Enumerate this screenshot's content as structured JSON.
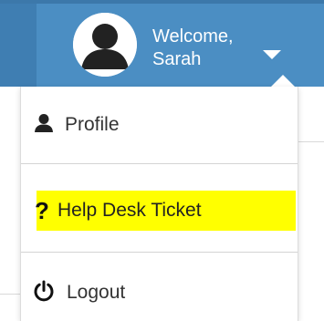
{
  "header": {
    "welcome": "Welcome,",
    "user_name": "Sarah",
    "avatar_icon": "user-avatar-icon",
    "caret_icon": "chevron-down-icon",
    "bar_color": "#4b8ec3"
  },
  "menu": {
    "items": [
      {
        "label": "Profile",
        "icon": "user-icon"
      },
      {
        "label": "Help Desk Ticket",
        "icon": "question-icon",
        "highlight": "#ffff00"
      },
      {
        "label": "Logout",
        "icon": "power-icon"
      }
    ]
  }
}
